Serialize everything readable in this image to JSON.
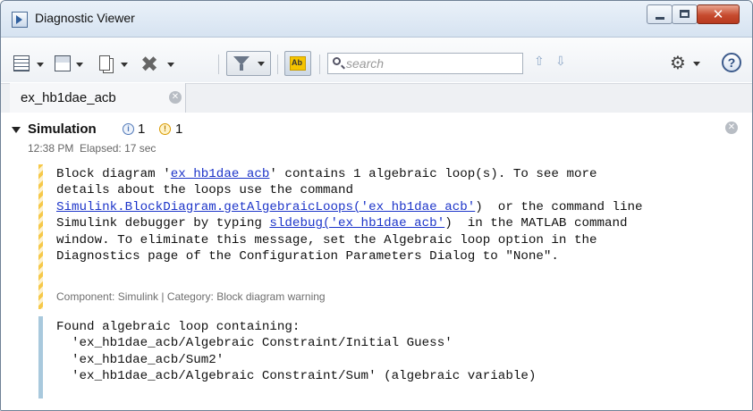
{
  "window": {
    "title": "Diagnostic Viewer"
  },
  "toolbar": {
    "search_placeholder": "search",
    "icons": [
      "view-options-icon",
      "save-icon",
      "copy-icon",
      "clear-icon",
      "filter-icon",
      "highlight-icon",
      "search-icon",
      "up-arrow-icon",
      "down-arrow-icon",
      "gear-icon",
      "help-icon"
    ]
  },
  "tab": {
    "label": "ex_hb1dae_acb"
  },
  "section": {
    "title": "Simulation",
    "info_count": "1",
    "warning_count": "1",
    "time": "12:38 PM",
    "elapsed": "Elapsed: 17 sec"
  },
  "message1": {
    "l1a": "Block diagram '",
    "l1link": "ex_hb1dae_acb",
    "l1b": "' contains 1 algebraic loop(s). To see more",
    "l2": "details about the loops use the command",
    "l3link": "Simulink.BlockDiagram.getAlgebraicLoops('ex_hb1dae_acb'",
    "l3b": ")  or the command line",
    "l4a": "Simulink debugger by typing ",
    "l4link": "sldebug('ex_hb1dae_acb'",
    "l4b": ")  in the MATLAB command",
    "l5": "window. To eliminate this message, set the Algebraic loop option in the",
    "l6": "Diagnostics page of the Configuration Parameters Dialog to \"None\".",
    "meta": "Component: Simulink | Category: Block diagram warning"
  },
  "message2": {
    "lines": [
      "Found algebraic loop containing:",
      "  'ex_hb1dae_acb/Algebraic Constraint/Initial Guess'",
      "  'ex_hb1dae_acb/Sum2'",
      "  'ex_hb1dae_acb/Algebraic Constraint/Sum' (algebraic variable)"
    ]
  },
  "colors": {
    "link": "#1d35c9",
    "warning_stripe": "#f6c94a",
    "info_stripe": "#a9c9dd",
    "close_button": "#c64b2f"
  }
}
